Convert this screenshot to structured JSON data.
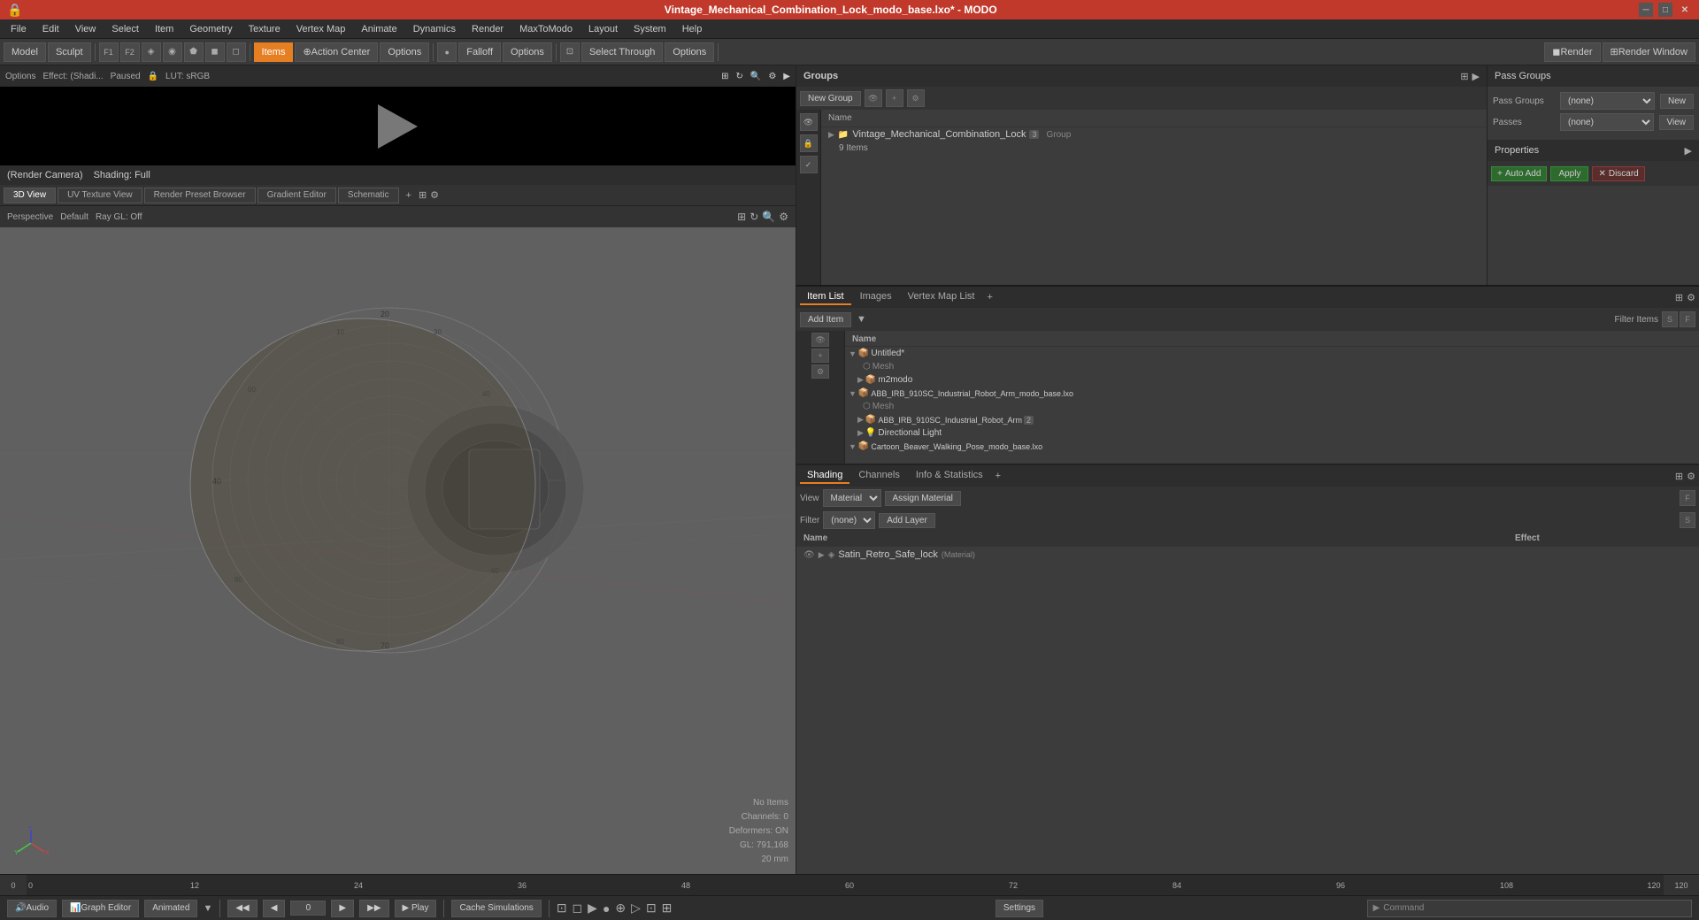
{
  "titlebar": {
    "title": "Vintage_Mechanical_Combination_Lock_modo_base.lxo* - MODO",
    "minimize": "─",
    "maximize": "□",
    "close": "✕"
  },
  "menubar": {
    "items": [
      "File",
      "Edit",
      "View",
      "Select",
      "Item",
      "Geometry",
      "Texture",
      "Vertex Map",
      "Animate",
      "Dynamics",
      "Render",
      "MaxToModo",
      "Layout",
      "System",
      "Help"
    ]
  },
  "toolbar": {
    "mode_buttons": [
      "Model",
      "Sculpt"
    ],
    "f1": "F1",
    "f2": "F2",
    "auto_select": "Auto Select",
    "items": "Items",
    "action_center": "Action Center",
    "options1": "Options",
    "falloff": "Falloff",
    "options2": "Options",
    "select_through": "Select Through",
    "options3": "Options",
    "render": "Render",
    "render_window": "Render Window"
  },
  "preview": {
    "effect_label": "Effect: (Shadi...",
    "paused": "Paused",
    "lut": "LUT: sRGB",
    "render_camera": "(Render Camera)",
    "shading": "Shading: Full"
  },
  "viewport": {
    "tabs": [
      "3D View",
      "UV Texture View",
      "Render Preset Browser",
      "Gradient Editor",
      "Schematic"
    ],
    "perspective": "Perspective",
    "default": "Default",
    "ray_gl": "Ray GL: Off",
    "stats": {
      "no_items": "No Items",
      "channels": "Channels: 0",
      "deformers": "Deformers: ON",
      "gl_coords": "GL: 791,168",
      "size": "20 mm"
    }
  },
  "groups": {
    "title": "Groups",
    "new_group_btn": "New Group",
    "name_header": "Name",
    "group_item": {
      "name": "Vintage_Mechanical_Combination_Lock",
      "badge": "3",
      "type": "Group",
      "sub": "9 Items"
    }
  },
  "pass_groups": {
    "label": "Pass Groups",
    "passes_label": "Passes",
    "group_value": "(none)",
    "passes_value": "(none)",
    "new_btn": "New"
  },
  "item_list": {
    "tabs": [
      "Item List",
      "Images",
      "Vertex Map List"
    ],
    "add_item": "Add Item",
    "filter_items": "Filter Items",
    "col_name": "Name",
    "items": [
      {
        "indent": 0,
        "arrow": "▼",
        "icon": "📦",
        "name": "Untitled*",
        "badge": "",
        "type": ""
      },
      {
        "indent": 1,
        "arrow": "",
        "icon": "⬡",
        "name": "Mesh",
        "badge": "",
        "type": "",
        "sub_indent": true
      },
      {
        "indent": 1,
        "arrow": "▶",
        "icon": "📦",
        "name": "m2modo",
        "badge": "",
        "type": ""
      },
      {
        "indent": 0,
        "arrow": "▼",
        "icon": "📦",
        "name": "ABB_IRB_910SC_Industrial_Robot_Arm_modo_base.lxo",
        "badge": "",
        "type": ""
      },
      {
        "indent": 1,
        "arrow": "",
        "icon": "⬡",
        "name": "Mesh",
        "badge": "",
        "type": "",
        "sub_indent": true
      },
      {
        "indent": 1,
        "arrow": "▶",
        "icon": "📦",
        "name": "ABB_IRB_910SC_Industrial_Robot_Arm",
        "badge": "2",
        "type": ""
      },
      {
        "indent": 1,
        "arrow": "▶",
        "icon": "💡",
        "name": "Directional Light",
        "badge": "",
        "type": ""
      },
      {
        "indent": 0,
        "arrow": "▼",
        "icon": "📦",
        "name": "Cartoon_Beaver_Walking_Pose_modo_base.lxo",
        "badge": "",
        "type": ""
      }
    ]
  },
  "shading": {
    "tabs": [
      "Shading",
      "Channels",
      "Info & Statistics"
    ],
    "view_label": "View",
    "view_value": "Material",
    "assign_material": "Assign Material",
    "filter_label": "Filter",
    "filter_value": "(none)",
    "add_layer": "Add Layer",
    "col_name": "Name",
    "col_effect": "Effect",
    "materials": [
      {
        "name": "Satin_Retro_Safe_lock",
        "type": "(Material)"
      }
    ]
  },
  "properties": {
    "title": "Properties",
    "auto_add": "Auto Add",
    "apply": "Apply",
    "discard": "Discard"
  },
  "timeline": {
    "marks": [
      "0",
      "12",
      "24",
      "36",
      "48",
      "60",
      "72",
      "84",
      "96",
      "108",
      "120"
    ],
    "end_mark": "120"
  },
  "statusbar": {
    "audio": "Audio",
    "graph_editor": "Graph Editor",
    "animated": "Animated",
    "frame_input": "0",
    "play": "Play",
    "cache_simulations": "Cache Simulations",
    "settings": "Settings",
    "command": "Command"
  },
  "colors": {
    "title_bg": "#c0392b",
    "toolbar_bg": "#3a3a3a",
    "panel_bg": "#3c3c3c",
    "dark_bg": "#2d2d2d",
    "active_tab": "#e67e22",
    "viewport_bg": "#6a6a6a",
    "items_active": "#e67e22"
  }
}
